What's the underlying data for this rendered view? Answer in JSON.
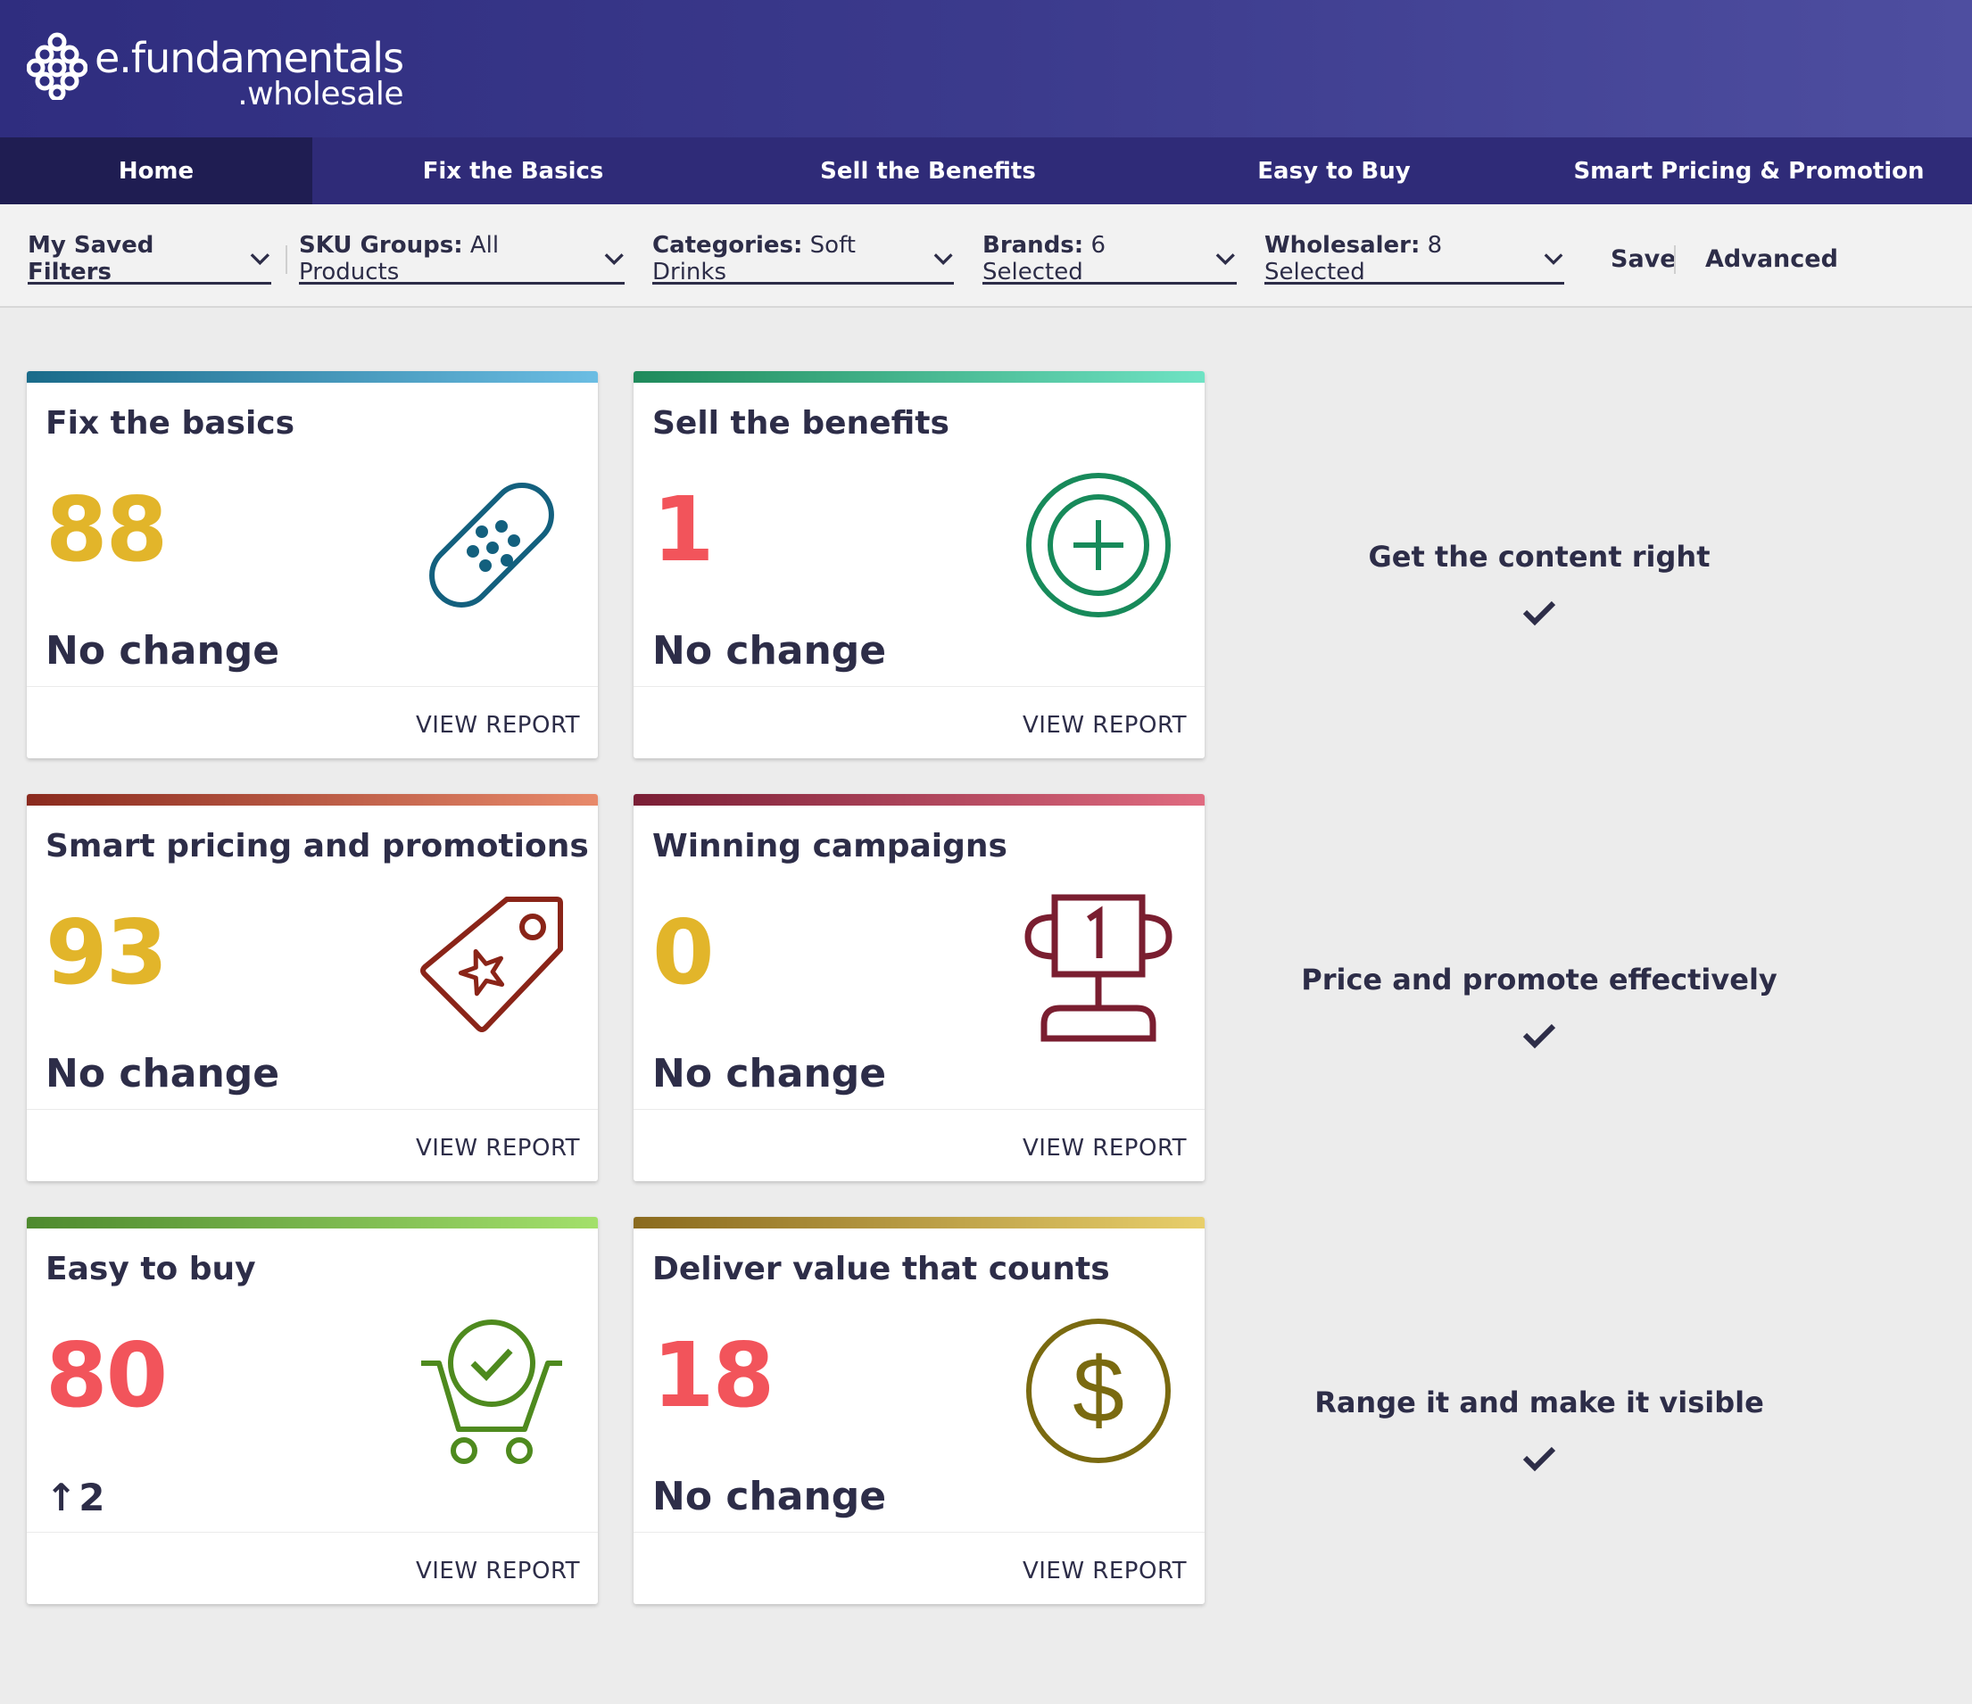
{
  "brand": {
    "name": "e.fundamentals",
    "sub": ".wholesale"
  },
  "nav": [
    {
      "label": "Home",
      "active": true
    },
    {
      "label": "Fix the Basics"
    },
    {
      "label": "Sell the Benefits"
    },
    {
      "label": "Easy to Buy"
    },
    {
      "label": "Smart Pricing & Promotion"
    }
  ],
  "filters": {
    "saved": {
      "label": "My Saved Filters"
    },
    "sku": {
      "label": "SKU Groups:",
      "value": "All Products"
    },
    "categories": {
      "label": "Categories:",
      "value": "Soft Drinks"
    },
    "brands": {
      "label": "Brands:",
      "value": "6 Selected"
    },
    "wholesaler": {
      "label": "Wholesaler:",
      "value": "8 Selected"
    },
    "save": "Save",
    "advanced": "Advanced"
  },
  "cards": [
    {
      "title": "Fix the basics",
      "score": "88",
      "score_color": "#e2b52a",
      "change": "No change",
      "report": "VIEW REPORT",
      "bar": [
        "#1a6b8a",
        "#6bbde3"
      ],
      "icon": "bandage-icon",
      "icon_color": "#13607e"
    },
    {
      "title": "Sell the benefits",
      "score": "1",
      "score_color": "#f2545b",
      "change": "No change",
      "report": "VIEW REPORT",
      "bar": [
        "#1f8a5b",
        "#6fe3c4"
      ],
      "icon": "plus-circle-icon",
      "icon_color": "#178a5a"
    },
    {
      "title": "Smart pricing and promotions",
      "score": "93",
      "score_color": "#e2b52a",
      "change": "No change",
      "report": "VIEW REPORT",
      "bar": [
        "#8a2a1e",
        "#e88a6b"
      ],
      "icon": "price-tag-star-icon",
      "icon_color": "#8a2418"
    },
    {
      "title": "Winning campaigns",
      "score": "0",
      "score_color": "#e2b52a",
      "change": "No change",
      "report": "VIEW REPORT",
      "bar": [
        "#7a1e35",
        "#e06b80"
      ],
      "icon": "trophy-icon",
      "icon_color": "#7a1e30"
    },
    {
      "title": "Easy to buy",
      "score": "80",
      "score_color": "#f2545b",
      "change_arrow": "↑",
      "change_value": "2",
      "report": "VIEW REPORT",
      "bar": [
        "#4e8a2e",
        "#a3e06b"
      ],
      "icon": "cart-check-icon",
      "icon_color": "#4e8a1e"
    },
    {
      "title": "Deliver value that counts",
      "score": "18",
      "score_color": "#f2545b",
      "change": "No change",
      "report": "VIEW REPORT",
      "bar": [
        "#8a6a1e",
        "#e8cf6b"
      ],
      "icon": "dollar-circle-icon",
      "icon_color": "#7a6a10"
    }
  ],
  "side_labels": [
    "Get the content right",
    "Price and promote effectively",
    "Range it and make it visible"
  ],
  "colors": {
    "header": "#3b3a8c",
    "nav": "#2f2b78",
    "nav_active": "#1f1d52",
    "text": "#2d2d48"
  }
}
